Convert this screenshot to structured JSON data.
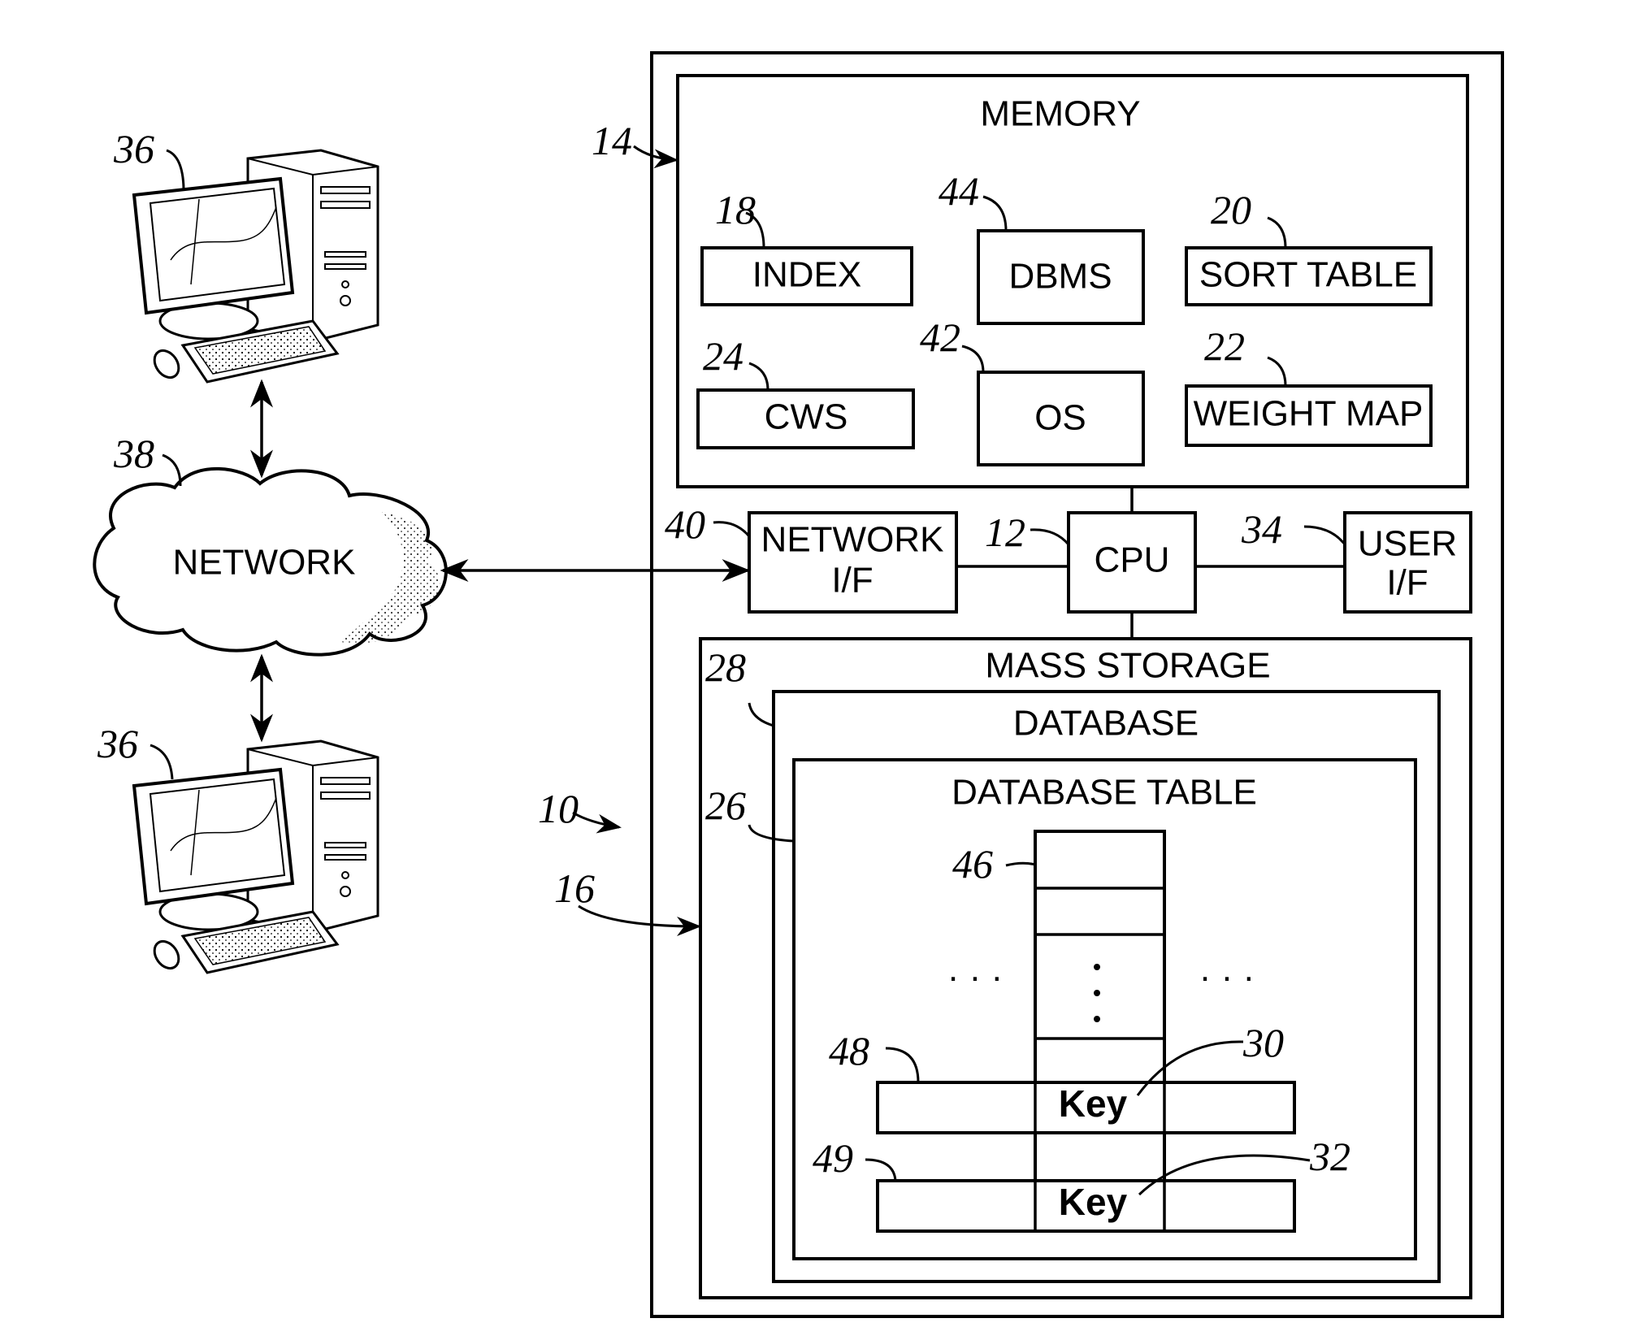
{
  "figure": {
    "refs": {
      "system": "10",
      "cpu": "12",
      "memory": "14",
      "mass_storage_arrow": "16",
      "index": "18",
      "sort_table": "20",
      "weight_map": "22",
      "cws": "24",
      "database_table": "26",
      "database": "28",
      "key1": "30",
      "key2": "32",
      "user_if": "34",
      "client_top": "36",
      "client_bottom": "36",
      "network": "38",
      "network_if": "40",
      "os": "42",
      "dbms": "44",
      "column": "46",
      "row1": "48",
      "row2": "49"
    },
    "labels": {
      "memory": "MEMORY",
      "index": "INDEX",
      "dbms": "DBMS",
      "sort_table": "SORT TABLE",
      "cws": "CWS",
      "os": "OS",
      "weight_map": "WEIGHT MAP",
      "network_if_1": "NETWORK",
      "network_if_2": "I/F",
      "cpu": "CPU",
      "user_if_1": "USER",
      "user_if_2": "I/F",
      "mass_storage": "MASS STORAGE",
      "database": "DATABASE",
      "database_table": "DATABASE TABLE",
      "key1": "Key",
      "key2": "Key",
      "network": "NETWORK",
      "ellipsis": "·  ·  ·"
    }
  }
}
